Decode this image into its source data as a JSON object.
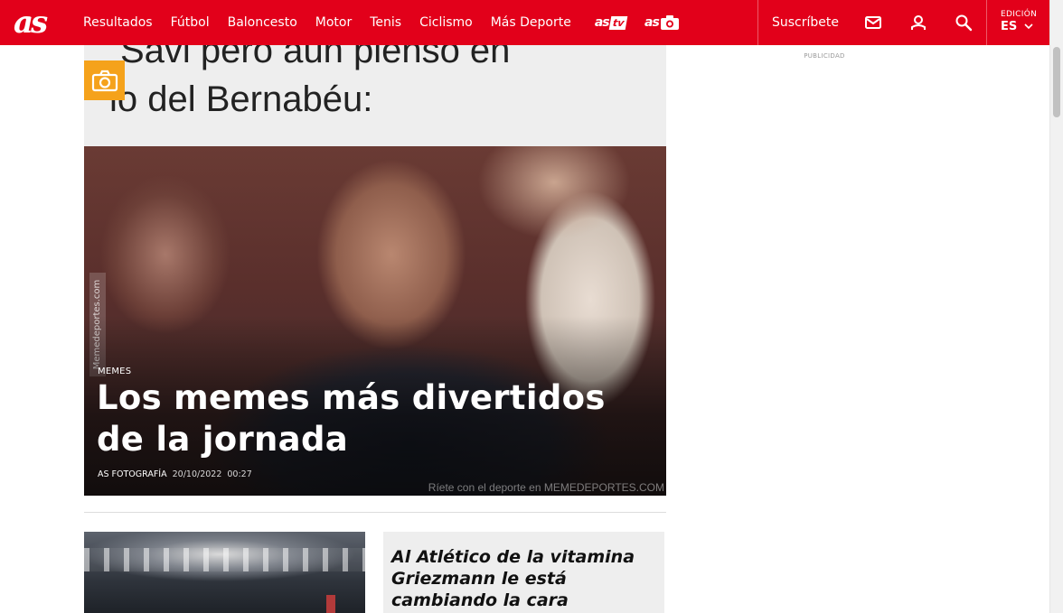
{
  "header": {
    "logo_text": "as",
    "nav": [
      "Resultados",
      "Fútbol",
      "Baloncesto",
      "Motor",
      "Tenis",
      "Ciclismo",
      "Más Deporte"
    ],
    "brands": [
      {
        "text": "as",
        "badge": "tv",
        "icon": "as-tv-logo"
      },
      {
        "text": "as",
        "icon": "as-photo-logo"
      }
    ],
    "subscribe_label": "Suscríbete",
    "icons": [
      "mail-icon",
      "user-icon",
      "search-icon"
    ],
    "edition_label": "EDICIÓN",
    "edition_value": "ES",
    "accent_color": "#e2001a"
  },
  "ad": {
    "label": "PUBLICIDAD"
  },
  "hero": {
    "image_text_line1": "Savi pero aún pienso en",
    "image_text_line2": "lo del Bernabéu:",
    "watermark": "Memedeportes.com",
    "footer_mark": "Ríete con el deporte en MEMEDEPORTES.COM",
    "kicker": "MEMES",
    "headline": "Los memes más divertidos de la jornada",
    "author": "AS FOTOGRAFÍA",
    "date": "20/10/2022",
    "time": "00:27",
    "badge_icon": "camera-icon",
    "badge_color": "#f5a21b"
  },
  "cards": [
    {
      "headline": "Al Atlético de la vitamina Griezmann le está cambiando la cara"
    }
  ]
}
